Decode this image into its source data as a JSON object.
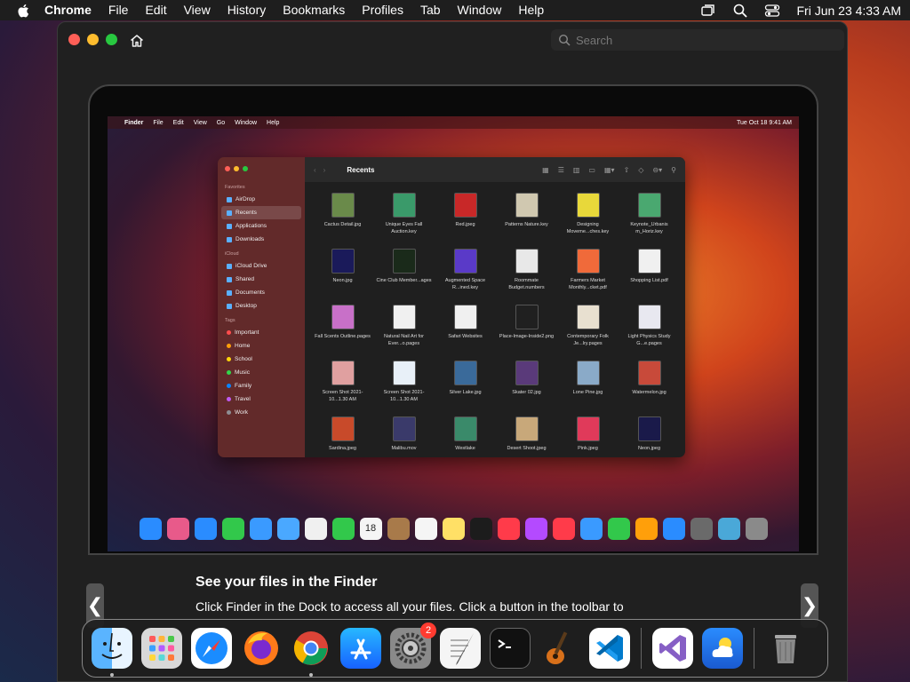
{
  "menubar": {
    "app_name": "Chrome",
    "items": [
      "File",
      "Edit",
      "View",
      "History",
      "Bookmarks",
      "Profiles",
      "Tab",
      "Window",
      "Help"
    ],
    "datetime": "Fri Jun 23  4:33 AM"
  },
  "browser": {
    "search_placeholder": "Search"
  },
  "inner_screen": {
    "menubar": {
      "app_name": "Finder",
      "items": [
        "File",
        "Edit",
        "View",
        "Go",
        "Window",
        "Help"
      ],
      "datetime": "Tue Oct 18  9:41 AM"
    },
    "finder": {
      "title": "Recents",
      "sidebar": {
        "favorites_label": "Favorites",
        "favorites": [
          "AirDrop",
          "Recents",
          "Applications",
          "Downloads"
        ],
        "icloud_label": "iCloud",
        "icloud": [
          "iCloud Drive",
          "Shared",
          "Documents",
          "Desktop"
        ],
        "tags_label": "Tags",
        "tags": [
          {
            "name": "Important",
            "color": "#ff4d4d"
          },
          {
            "name": "Home",
            "color": "#ff9f0a"
          },
          {
            "name": "School",
            "color": "#ffd60a"
          },
          {
            "name": "Music",
            "color": "#32d74b"
          },
          {
            "name": "Family",
            "color": "#0a84ff"
          },
          {
            "name": "Travel",
            "color": "#bf5af2"
          },
          {
            "name": "Work",
            "color": "#8e8e93"
          }
        ]
      },
      "files": [
        "Cactus Detail.jpg",
        "Unique Eyes Fall Auction.key",
        "Red.jpeg",
        "Patterns Nature.key",
        "Designing Moveme...ches.key",
        "Keynote_Urbanis m_Horiz.key",
        "Neon.jpg",
        "Cine Club Member...ages",
        "Augmented Space R...ined.key",
        "Roommate Budget.numbers",
        "Farmers Market Monthly...cket.pdf",
        "Shopping List.pdf",
        "Fall Scents Outline.pages",
        "Natural Nail Art for Ever...o.pages",
        "Safari Websites",
        "Place-Image-Inside2.png",
        "Contemporary Folk Je...lry.pages",
        "Light Physics Study G...e.pages",
        "Screen Shot 2021-10...1.30 AM",
        "Screen Shot 2021-10...1.30 AM",
        "Silver Lake.jpg",
        "Skater 02.jpg",
        "Lone Pine.jpg",
        "Watermelon.jpg",
        "Sardina.jpeg",
        "Malibu.mov",
        "Westlake",
        "Desert Shoot.jpeg",
        "Pink.jpeg",
        "Neon.jpeg"
      ],
      "file_colors": [
        "#6a8a4a",
        "#3a9a6a",
        "#c82828",
        "#d0c8b0",
        "#e8d83a",
        "#4aa870",
        "#1a1a5a",
        "#1a2a1a",
        "#5a3ac8",
        "#e8e8e8",
        "#f06a3a",
        "#f0f0f0",
        "#c870c8",
        "#f0f0f0",
        "#f0f0f0",
        "#202020",
        "#e8e0d0",
        "#e8e8f0",
        "#e0a0a0",
        "#e8f0f8",
        "#3a6a9a",
        "#5a3a7a",
        "#8aaac8",
        "#c84a3a",
        "#c84a2a",
        "#3a3a6a",
        "#3a8a6a",
        "#c8a87a",
        "#e03a5a",
        "#1a1a4a"
      ]
    },
    "dock_colors": [
      "#2a8cff",
      "#e85a8a",
      "#2a8cff",
      "#32c84b",
      "#3a9aff",
      "#4aa8ff",
      "#f0f0f0",
      "#32c84b",
      "#f5f5f5",
      "#a87a4a",
      "#f5f5f5",
      "#ffe066",
      "#1c1c1c",
      "#ff3b4a",
      "#b44aff",
      "#ff3b4a",
      "#3a9aff",
      "#32c84b",
      "#ff9f0a",
      "#2a8cff",
      "#6a6a6a",
      "#4aa8d8",
      "#8a8a8a"
    ],
    "dock_calendar_day": "18"
  },
  "tutorial": {
    "title": "See your files in the Finder",
    "body": "Click Finder  in the Dock to access all your files. Click a button in the toolbar to"
  },
  "nav": {
    "prev": "❮",
    "next": "❯"
  },
  "dock": {
    "settings_badge": "2"
  }
}
